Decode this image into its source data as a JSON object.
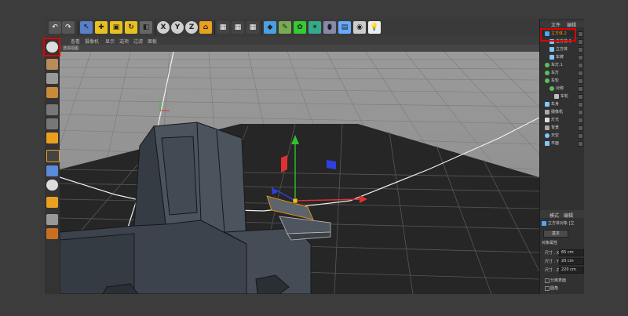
{
  "toolbar": {
    "undo_icon": "undo-icon",
    "axis_x": "X",
    "axis_y": "Y",
    "axis_z": "Z"
  },
  "menubar": {
    "items": [
      "查看",
      "摄像机",
      "显示",
      "选项",
      "过滤",
      "面板"
    ]
  },
  "viewport": {
    "label": "透视视图"
  },
  "object_manager": {
    "tabs": [
      "文件",
      "编辑"
    ],
    "objects": [
      {
        "name": "立方体.2",
        "selected": true,
        "color": "#4aa8ff"
      },
      {
        "name": "立方体.1",
        "selected": false,
        "color": "#7fc7ff"
      },
      {
        "name": "立方体",
        "selected": false,
        "color": "#7fc7ff"
      },
      {
        "name": "车牌",
        "selected": false,
        "color": "#7fc7ff"
      },
      {
        "name": "车灯.1",
        "selected": false,
        "color": "#58c058"
      },
      {
        "name": "车灯",
        "selected": false,
        "color": "#58c058"
      },
      {
        "name": "车轮",
        "selected": false,
        "color": "#58c058"
      },
      {
        "name": "对称",
        "selected": false,
        "color": "#58c058"
      },
      {
        "name": "车轮",
        "selected": false,
        "color": "#c0c0c0"
      },
      {
        "name": "车身",
        "selected": false,
        "color": "#7fc7ff"
      },
      {
        "name": "摄像机",
        "selected": false,
        "color": "#aaaaaa"
      },
      {
        "name": "灯光",
        "selected": false,
        "color": "#dddddd"
      },
      {
        "name": "背景",
        "selected": false,
        "color": "#aaaaaa"
      },
      {
        "name": "天空",
        "selected": false,
        "color": "#7fc7ff"
      },
      {
        "name": "平面",
        "selected": false,
        "color": "#7fc7ff"
      }
    ]
  },
  "attributes": {
    "tabs": [
      "模式",
      "编辑"
    ],
    "object_title": "立方体对象 [立",
    "basic_button": "基本",
    "section": "对象属性",
    "size_x_label": "尺寸 . X",
    "size_x": "65 cm",
    "size_y_label": "尺寸 . Y",
    "size_y": "20 cm",
    "size_z_label": "尺寸 . Z",
    "size_z": "220 cm",
    "separate_surfaces": "分离表面",
    "fillet": "圆角"
  },
  "colors": {
    "highlight_red": "#e00000",
    "selection_orange": "#ff9a00",
    "axis_x": "#e03030",
    "axis_y": "#30c030",
    "axis_z": "#3040e0"
  }
}
